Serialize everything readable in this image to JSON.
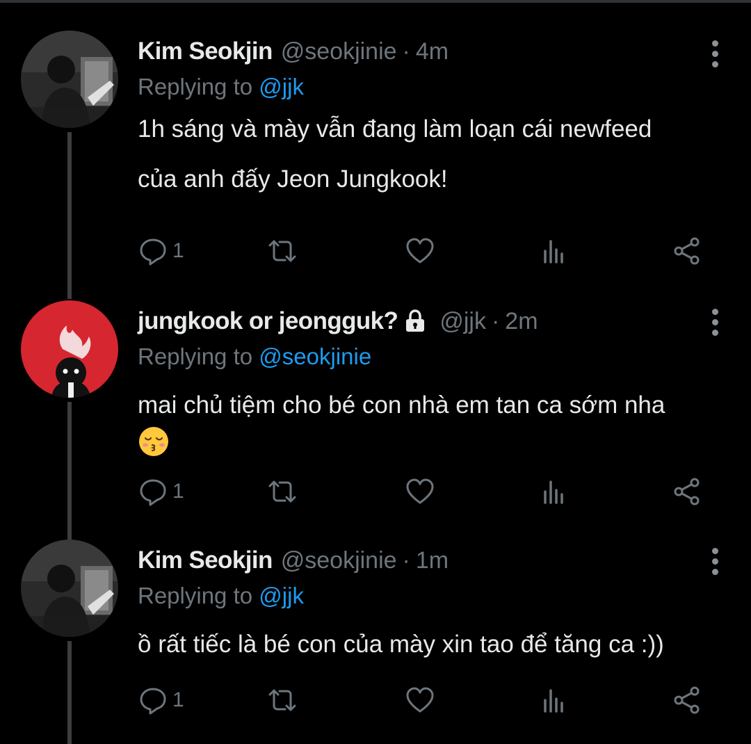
{
  "tweets": [
    {
      "display_name": "Kim Seokjin",
      "handle": "@seokjinie",
      "separator": "·",
      "time": "4m",
      "replying_prefix": "Replying to",
      "replying_to": "@jjk",
      "text_line1": "1h sáng và mày vẫn đang làm loạn cái newfeed",
      "text_line2": "của anh đấy Jeon Jungkook!",
      "reply_count": "1",
      "avatar": "studio-photo-avatar"
    },
    {
      "display_name": "jungkook or jeongguk?",
      "protected_icon": "lock-icon",
      "handle": "@jjk",
      "separator": "·",
      "time": "2m",
      "replying_prefix": "Replying to",
      "replying_to": "@seokjinie",
      "text_line1": "mai chủ tiệm cho bé con nhà em tan ca sớm nha",
      "emoji": "kissing-face-closed-eyes-emoji",
      "reply_count": "1",
      "avatar": "red-illustration-avatar"
    },
    {
      "display_name": "Kim Seokjin",
      "handle": "@seokjinie",
      "separator": "·",
      "time": "1m",
      "replying_prefix": "Replying to",
      "replying_to": "@jjk",
      "text_line1": "ồ rất tiếc là bé con của mày xin tao để tăng ca :))",
      "reply_count": "1",
      "avatar": "studio-photo-avatar"
    }
  ],
  "icons": {
    "reply": "reply-icon",
    "retweet": "retweet-icon",
    "like": "heart-icon",
    "stats": "analytics-icon",
    "share": "share-icon",
    "more": "more-vertical-icon"
  },
  "colors": {
    "background": "#000000",
    "text": "#e7e9ea",
    "muted": "#6e767d",
    "link": "#1d9bf0",
    "thread_line": "#3d3d3d",
    "avatar_red": "#d6262f"
  }
}
